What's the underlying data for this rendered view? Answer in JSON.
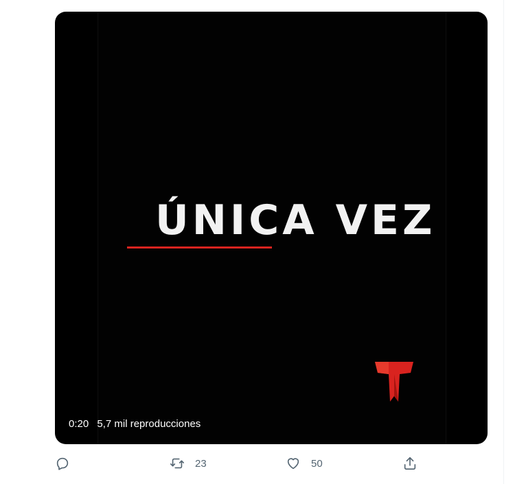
{
  "video": {
    "overlay_title": "ÚNICA VEZ",
    "duration": "0:20",
    "views": "5,7 mil reproducciones",
    "accent_color": "#d9231f",
    "logo": "telemundo-logo"
  },
  "actions": {
    "reply": {
      "icon": "reply-icon",
      "count": ""
    },
    "retweet": {
      "icon": "retweet-icon",
      "count": "23"
    },
    "like": {
      "icon": "heart-icon",
      "count": "50"
    },
    "share": {
      "icon": "share-icon"
    }
  }
}
